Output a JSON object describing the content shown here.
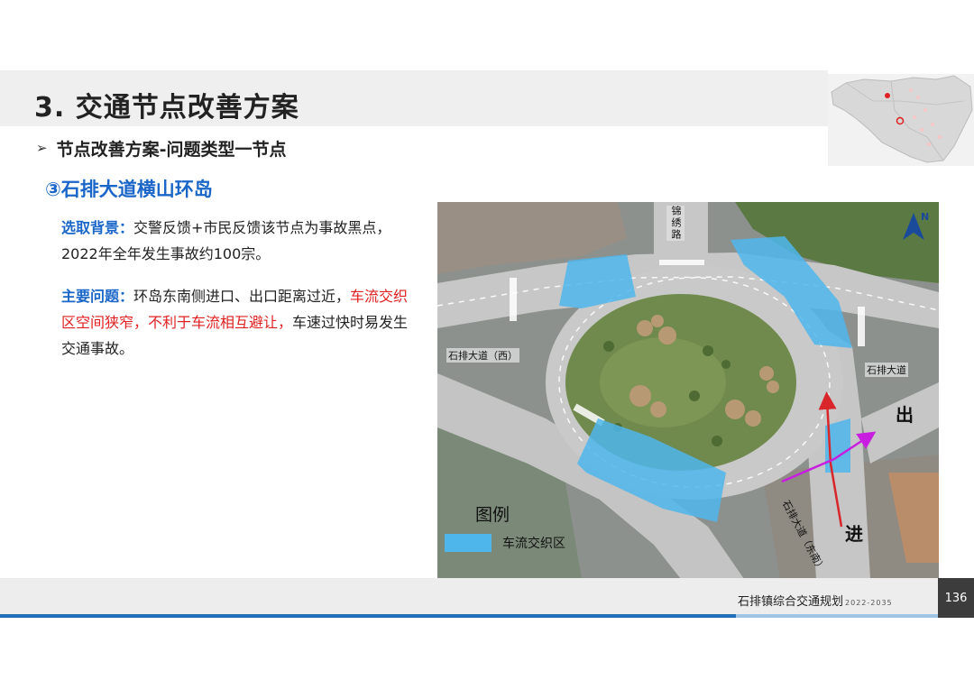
{
  "header": {
    "title": "3. 交通节点改善方案"
  },
  "subtitle": {
    "bullet": "➢",
    "text": "节点改善方案-问题类型一节点"
  },
  "section": {
    "title": "③石排大道横山环岛"
  },
  "background": {
    "label": "选取背景：",
    "text": "交警反馈+市民反馈该节点为事故黑点，2022年全年发生事故约100宗。"
  },
  "problem": {
    "label": "主要问题：",
    "text_1": "环岛东南侧进口、出口距离过近，",
    "text_red": "车流交织区空间狭窄，不利于车流相互避让，",
    "text_2": "车速过快时易发生交通事故。"
  },
  "map": {
    "road_north": "锦绣路",
    "road_west": "石排大道（西）",
    "road_east": "石排大道",
    "road_southeast": "石排大道（东南）",
    "exit_mark": "出",
    "entry_mark": "进",
    "north_symbol": "N",
    "legend_title": "图例",
    "legend_item": "车流交织区",
    "colors": {
      "weaving_zone": "#4fb6ec",
      "entry_arrow": "#d9262b",
      "exit_arrow": "#c81ee0"
    }
  },
  "footer": {
    "plan_name": "石排镇综合交通规划",
    "years": "2022-2035",
    "page": "136"
  }
}
